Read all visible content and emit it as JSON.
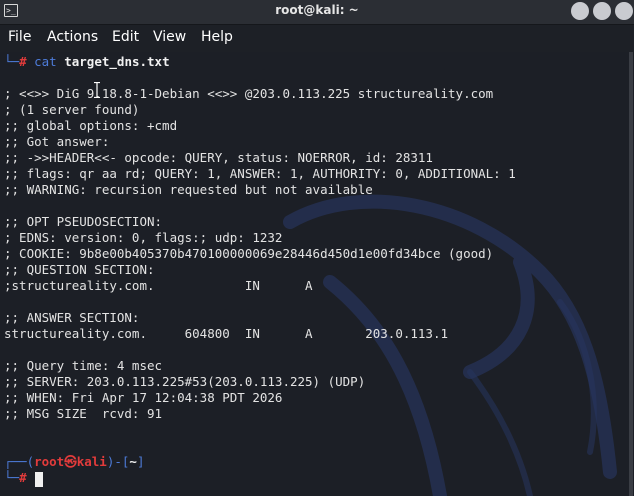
{
  "window": {
    "title": "root@kali: ~",
    "icon": "terminal-app-icon"
  },
  "menu": {
    "file": "File",
    "actions": "Actions",
    "edit": "Edit",
    "view": "View",
    "help": "Help"
  },
  "prev_prompt": {
    "corner": "└─",
    "hash": "#",
    "command": "cat",
    "argument": "target_dns.txt"
  },
  "output": [
    "; <<>> DiG 9.18.8-1-Debian <<>> @203.0.113.225 structureality.com",
    "; (1 server found)",
    ";; global options: +cmd",
    ";; Got answer:",
    ";; ->>HEADER<<- opcode: QUERY, status: NOERROR, id: 28311",
    ";; flags: qr aa rd; QUERY: 1, ANSWER: 1, AUTHORITY: 0, ADDITIONAL: 1",
    ";; WARNING: recursion requested but not available",
    "",
    ";; OPT PSEUDOSECTION:",
    "; EDNS: version: 0, flags:; udp: 1232",
    "; COOKIE: 9b8e00b405370b470100000069e28446d450d1e00fd34bce (good)",
    ";; QUESTION SECTION:",
    ";structureality.com.            IN      A",
    "",
    ";; ANSWER SECTION:",
    "structureality.com.     604800  IN      A       203.0.113.1",
    "",
    ";; Query time: 4 msec",
    ";; SERVER: 203.0.113.225#53(203.0.113.225) (UDP)",
    ";; WHEN: Fri Apr 17 12:04:38 PDT 2026",
    ";; MSG SIZE  rcvd: 91"
  ],
  "prompt": {
    "open": "┌──(",
    "user": "root",
    "at": "㉿",
    "host": "kali",
    "mid": ")-[",
    "path": "~",
    "close": "]",
    "corner": "└─",
    "hash": "#"
  },
  "colors": {
    "accent_blue": "#4d7bd8",
    "root_red": "#e23b3b",
    "background": "#1c1f26"
  }
}
